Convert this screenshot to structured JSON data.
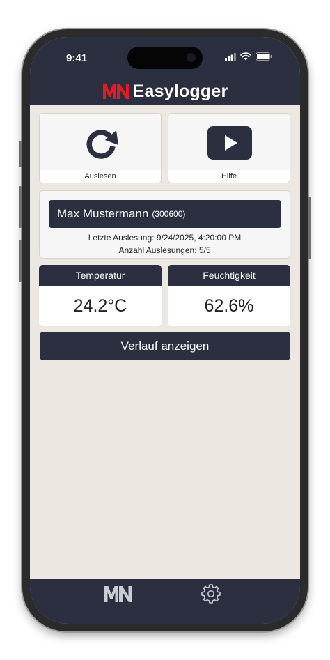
{
  "status": {
    "time": "9:41"
  },
  "app": {
    "brand_mark": "MN",
    "brand_name": "Easylogger",
    "accent_color": "#e31b23",
    "header_color": "#2b2f40"
  },
  "actions": {
    "read_label": "Auslesen",
    "help_label": "Hilfe"
  },
  "device": {
    "name": "Max Mustermann",
    "id": "(300600)",
    "last_read": "Letzte Auslesung: 9/24/2025, 4:20:00 PM",
    "read_count": "Anzahl Auslesungen: 5/5"
  },
  "measurements": {
    "temperature": {
      "label": "Temperatur",
      "value": "24.2°C"
    },
    "humidity": {
      "label": "Feuchtigkeit",
      "value": "62.6%"
    }
  },
  "history_button": "Verlauf anzeigen",
  "tabbar": {
    "home_icon": "mn-logo-icon",
    "settings_icon": "gear-icon"
  }
}
